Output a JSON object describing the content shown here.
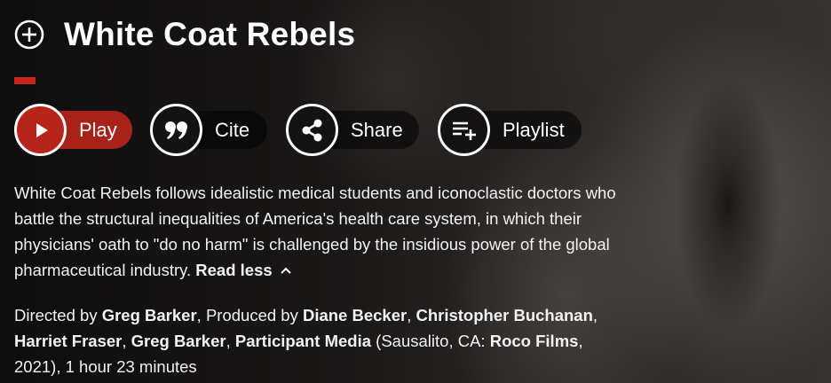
{
  "title": "White Coat Rebels",
  "colors": {
    "accent": "#c8261d",
    "play_button": "#b72419"
  },
  "actions": [
    {
      "label": "Play",
      "icon": "play-icon"
    },
    {
      "label": "Cite",
      "icon": "quote-icon"
    },
    {
      "label": "Share",
      "icon": "share-icon"
    },
    {
      "label": "Playlist",
      "icon": "playlist-add-icon"
    }
  ],
  "description": {
    "text": "White Coat Rebels follows idealistic medical students and iconoclastic doctors who battle the structural inequalities of America's health care system, in which their physicians' oath to \"do no harm\" is challenged by the insidious power of the global pharmaceutical industry.",
    "toggle_label": "Read less"
  },
  "credits": {
    "directed_prefix": "Directed by ",
    "director": "Greg Barker",
    "produced_prefix": ", Produced by ",
    "producers": [
      "Diane Becker",
      "Christopher Buchanan",
      "Harriet Fraser",
      "Greg Barker",
      "Participant Media"
    ],
    "sep": ", ",
    "location_prefix": " (Sausalito, CA: ",
    "publisher": "Roco Films",
    "suffix": ", 2021), 1 hour 23 minutes"
  }
}
